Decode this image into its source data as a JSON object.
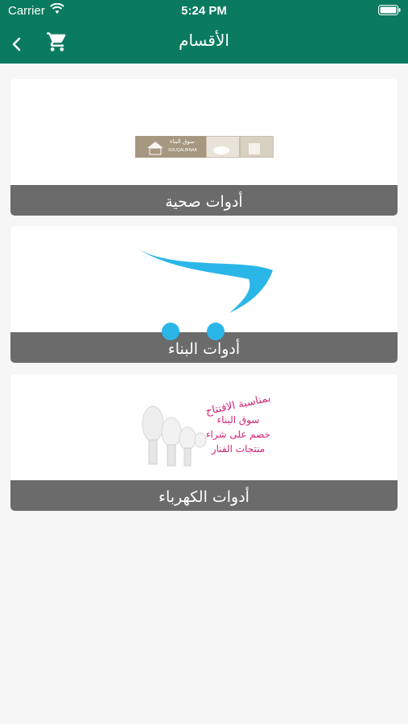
{
  "status_bar": {
    "carrier": "Carrier",
    "time": "5:24 PM"
  },
  "nav": {
    "title": "الأقسام"
  },
  "categories": [
    {
      "label": "أدوات صحية",
      "banner_text": "سوق البناء",
      "banner_sub": "SOUQALBINAA"
    },
    {
      "label": "أدوات البناء"
    },
    {
      "label": "أدوات الكهرباء",
      "promo_lines": [
        "بمناسبة الافتتاح",
        "سوق البناء",
        "خصم على شراء",
        "منتجات الفنار"
      ]
    }
  ],
  "colors": {
    "primary": "#0a7a60",
    "label_band": "#6b6b6b",
    "cart_blue": "#2bb6e8",
    "promo_pink": "#d0277a"
  }
}
